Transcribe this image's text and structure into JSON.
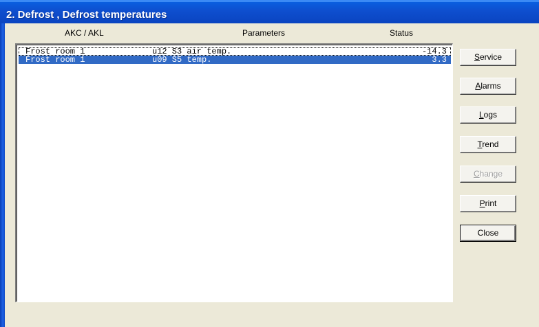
{
  "window": {
    "title": "2. Defrost , Defrost temperatures"
  },
  "columns": {
    "akc": "AKC / AKL",
    "parameters": "Parameters",
    "status": "Status"
  },
  "rows": [
    {
      "room": "Frost room 1",
      "parameter": "u12 S3 air temp.",
      "status": "-14.3",
      "selected": false
    },
    {
      "room": "Frost room 1",
      "parameter": "u09 S5 temp.",
      "status": "3.3",
      "selected": true
    }
  ],
  "buttons": {
    "service": {
      "mnemonic": "S",
      "rest": "ervice"
    },
    "alarms": {
      "mnemonic": "A",
      "rest": "larms"
    },
    "logs": {
      "mnemonic": "L",
      "rest": "ogs"
    },
    "trend": {
      "mnemonic": "T",
      "rest": "rend"
    },
    "change": {
      "mnemonic": "C",
      "rest": "hange",
      "enabled": false
    },
    "print": {
      "mnemonic": "P",
      "rest": "rint"
    },
    "close": {
      "label": "Close"
    }
  },
  "colors": {
    "titlebar": "#0a4fd0",
    "selection": "#316ac5",
    "dialog": "#ece9d8"
  }
}
